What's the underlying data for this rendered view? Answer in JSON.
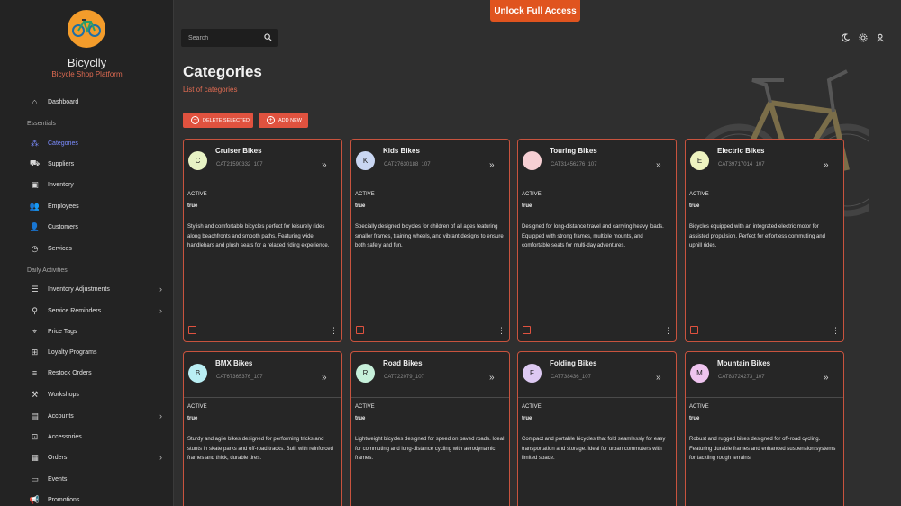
{
  "brand": {
    "title": "Bicyclly",
    "subtitle": "Bicycle Shop Platform"
  },
  "topbar": {
    "unlock_label": "Unlock Full Access",
    "search_placeholder": "Search"
  },
  "sidebar": {
    "items": [
      {
        "label": "Dashboard",
        "icon": "home-icon"
      },
      {
        "label": "Categories",
        "icon": "categories-icon",
        "active": true
      },
      {
        "label": "Suppliers",
        "icon": "truck-icon"
      },
      {
        "label": "Inventory",
        "icon": "archive-icon"
      },
      {
        "label": "Employees",
        "icon": "users-icon"
      },
      {
        "label": "Customers",
        "icon": "user-icon"
      },
      {
        "label": "Services",
        "icon": "services-icon"
      },
      {
        "label": "Inventory Adjustments",
        "icon": "sliders-icon",
        "expandable": true
      },
      {
        "label": "Service Reminders",
        "icon": "reminder-icon",
        "expandable": true
      },
      {
        "label": "Price Tags",
        "icon": "tag-icon"
      },
      {
        "label": "Loyalty Programs",
        "icon": "gift-icon"
      },
      {
        "label": "Restock Orders",
        "icon": "list-icon"
      },
      {
        "label": "Workshops",
        "icon": "wrench-icon"
      },
      {
        "label": "Accounts",
        "icon": "account-icon",
        "expandable": true
      },
      {
        "label": "Accessories",
        "icon": "accessories-icon"
      },
      {
        "label": "Orders",
        "icon": "orders-icon",
        "expandable": true
      },
      {
        "label": "Events",
        "icon": "events-icon"
      },
      {
        "label": "Promotions",
        "icon": "megaphone-icon"
      }
    ],
    "sections": {
      "essentials": "Essentials",
      "daily": "Daily Activities"
    }
  },
  "header": {
    "title": "Categories",
    "subtitle": "List of categories"
  },
  "actions": {
    "delete_selected": "DELETE SELECTED",
    "add_new": "ADD NEW"
  },
  "cards": [
    {
      "initial": "C",
      "title": "Cruiser Bikes",
      "id": "CAT21590332_107",
      "status_label": "ACTIVE",
      "status": "true",
      "color": "#e7f3c4",
      "description": "Stylish and comfortable bicycles perfect for leisurely rides along beachfronts and smooth paths. Featuring wide handlebars and plush seats for a relaxed riding experience."
    },
    {
      "initial": "K",
      "title": "Kids Bikes",
      "id": "CAT27630188_107",
      "status_label": "ACTIVE",
      "status": "true",
      "color": "#c9d6f2",
      "description": "Specially designed bicycles for children of all ages featuring smaller frames, training wheels, and vibrant designs to ensure both safety and fun."
    },
    {
      "initial": "T",
      "title": "Touring Bikes",
      "id": "CAT31456276_107",
      "status_label": "ACTIVE",
      "status": "true",
      "color": "#f6cfd3",
      "description": "Designed for long-distance travel and carrying heavy loads. Equipped with strong frames, multiple mounts, and comfortable seats for multi-day adventures."
    },
    {
      "initial": "E",
      "title": "Electric Bikes",
      "id": "CAT39717014_107",
      "status_label": "ACTIVE",
      "status": "true",
      "color": "#eef3c0",
      "description": "Bicycles equipped with an integrated electric motor for assisted propulsion. Perfect for effortless commuting and uphill rides."
    },
    {
      "initial": "B",
      "title": "BMX Bikes",
      "id": "CAT67365376_107",
      "status_label": "ACTIVE",
      "status": "true",
      "color": "#b9eef3",
      "description": "Sturdy and agile bikes designed for performing tricks and stunts in skate parks and off-road tracks. Built with reinforced frames and thick, durable tires."
    },
    {
      "initial": "R",
      "title": "Road Bikes",
      "id": "CAT722079_107",
      "status_label": "ACTIVE",
      "status": "true",
      "color": "#c6f0da",
      "description": "Lightweight bicycles designed for speed on paved roads. Ideal for commuting and long-distance cycling with aerodynamic frames."
    },
    {
      "initial": "F",
      "title": "Folding Bikes",
      "id": "CAT738436_107",
      "status_label": "ACTIVE",
      "status": "true",
      "color": "#ddc9f2",
      "description": "Compact and portable bicycles that fold seamlessly for easy transportation and storage. Ideal for urban commuters with limited space."
    },
    {
      "initial": "M",
      "title": "Mountain Bikes",
      "id": "CAT83724273_107",
      "status_label": "ACTIVE",
      "status": "true",
      "color": "#efc4ef",
      "description": "Robust and rugged bikes designed for off-road cycling. Featuring durable frames and enhanced suspension systems for tackling rough terrains."
    }
  ]
}
